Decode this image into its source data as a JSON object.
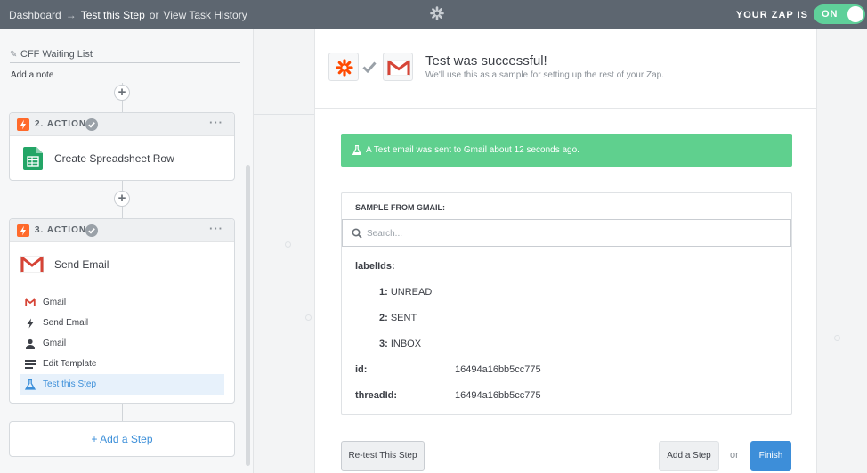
{
  "topbar": {
    "dashboard_link": "Dashboard",
    "arrow": "→",
    "current_step": "Test this Step",
    "or_text": "or",
    "history_link": "View Task History",
    "zap_status_label": "YOUR ZAP IS",
    "toggle_label": "ON",
    "logo_icon": "asterisk-icon"
  },
  "sidebar": {
    "zap_name": "CFF Waiting List",
    "add_note": "Add a note",
    "steps": [
      {
        "label": "2. ACTION",
        "title": "Create Spreadsheet Row",
        "app_icon": "google-sheets-icon",
        "menu": "···"
      },
      {
        "label": "3. ACTION",
        "title": "Send Email",
        "app_icon": "gmail-icon",
        "menu": "···",
        "sub_items": [
          {
            "label": "Gmail",
            "icon": "gmail-icon"
          },
          {
            "label": "Send Email",
            "icon": "bolt-icon"
          },
          {
            "label": "Gmail",
            "icon": "user-icon"
          },
          {
            "label": "Edit Template",
            "icon": "list-icon"
          },
          {
            "label": "Test this Step",
            "icon": "flask-icon",
            "active": true
          }
        ]
      }
    ],
    "add_step": "+ Add a Step"
  },
  "main": {
    "success_title": "Test was successful!",
    "success_sub": "We'll use this as a sample for setting up the rest of your Zap.",
    "alert": "A Test email was sent to Gmail about 12 seconds ago.",
    "sample_header": "SAMPLE FROM GMAIL:",
    "search_placeholder": "Search...",
    "fields": {
      "label_ids_key": "labelIds:",
      "label_ids": [
        {
          "index": "1:",
          "value": "UNREAD"
        },
        {
          "index": "2:",
          "value": "SENT"
        },
        {
          "index": "3:",
          "value": "INBOX"
        }
      ],
      "id_key": "id:",
      "id_value": "16494a16bb5cc775",
      "thread_key": "threadId:",
      "thread_value": "16494a16bb5cc775"
    },
    "retest_button": "Re-test This Step",
    "add_step_button": "Add a Step",
    "or_text": "or",
    "finish_button": "Finish"
  },
  "colors": {
    "topbar": "#5d6670",
    "toggle_on": "#5fd09a",
    "alert_green": "#5fd08e",
    "primary_blue": "#3d8ed9",
    "zapier_orange": "#ff6a2b"
  }
}
